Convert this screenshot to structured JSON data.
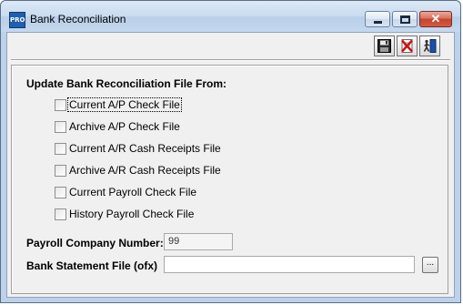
{
  "window": {
    "title": "Bank Reconciliation",
    "app_icon_text": "PRO"
  },
  "toolbar": {
    "buttons": [
      {
        "name": "save",
        "icon": "floppy-disk-icon"
      },
      {
        "name": "cancel",
        "icon": "cancel-document-icon"
      },
      {
        "name": "exit",
        "icon": "exit-door-icon"
      }
    ]
  },
  "form": {
    "heading": "Update Bank Reconciliation File From:",
    "options": [
      {
        "label": "Current A/P Check File",
        "checked": false,
        "focused": true
      },
      {
        "label": "Archive A/P Check File",
        "checked": false
      },
      {
        "label": "Current A/R Cash Receipts File",
        "checked": false
      },
      {
        "label": "Archive A/R Cash Receipts File",
        "checked": false
      },
      {
        "label": "Current Payroll Check File",
        "checked": false
      },
      {
        "label": "History Payroll Check File",
        "checked": false
      }
    ],
    "payroll_company_label": "Payroll Company Number:",
    "payroll_company_value": "99",
    "bank_statement_label": "Bank Statement File (ofx)",
    "bank_statement_value": "",
    "browse_label": "..."
  }
}
